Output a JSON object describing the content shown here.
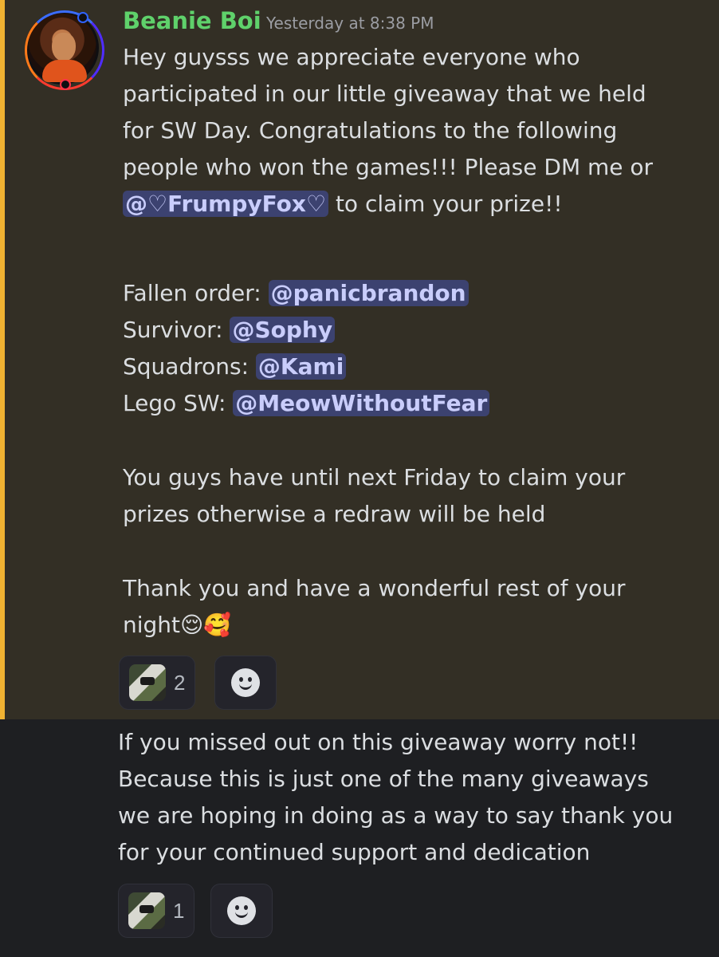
{
  "message": {
    "author": "Beanie Boi",
    "author_color": "#5fd16b",
    "timestamp": "Yesterday at 8:38 PM",
    "intro_lines": [
      "Hey guysss we appreciate everyone who",
      "participated in our little giveaway that we held",
      "for SW Day. Congratulations to the following",
      "people who won the games!!! Please DM me or"
    ],
    "intro_last": {
      "mention": "@♡FrumpyFox♡",
      "suffix": " to claim your prize!!"
    },
    "winners": [
      {
        "game": "Fallen order: ",
        "mention": "@panicbrandon"
      },
      {
        "game": "Survivor: ",
        "mention": "@Sophy"
      },
      {
        "game": "Squadrons: ",
        "mention": "@Kami"
      },
      {
        "game": "Lego SW: ",
        "mention": "@MeowWithoutFear"
      }
    ],
    "deadline_lines": [
      "You guys have until next Friday to claim your",
      "prizes otherwise a redraw will be held"
    ],
    "thanks_line_1": "Thank you and have a wonderful rest of your",
    "thanks_line_2": "night😌🥰",
    "reaction_count": "2"
  },
  "followup": {
    "lines": [
      "If you missed out on this giveaway worry not!!",
      "Because this is just one of the many giveaways",
      "we are hoping in doing as a way to say thank you",
      "for your continued support and dedication"
    ],
    "reaction_count": "1"
  },
  "icons": {
    "add_reaction": "smiley-icon",
    "reaction_emoji": "custom-emoji-icon"
  },
  "colors": {
    "highlight_bg": "#332f25",
    "highlight_bar": "#f0b232",
    "mention_bg": "#3c4270",
    "mention_text": "#c9cdfb"
  }
}
